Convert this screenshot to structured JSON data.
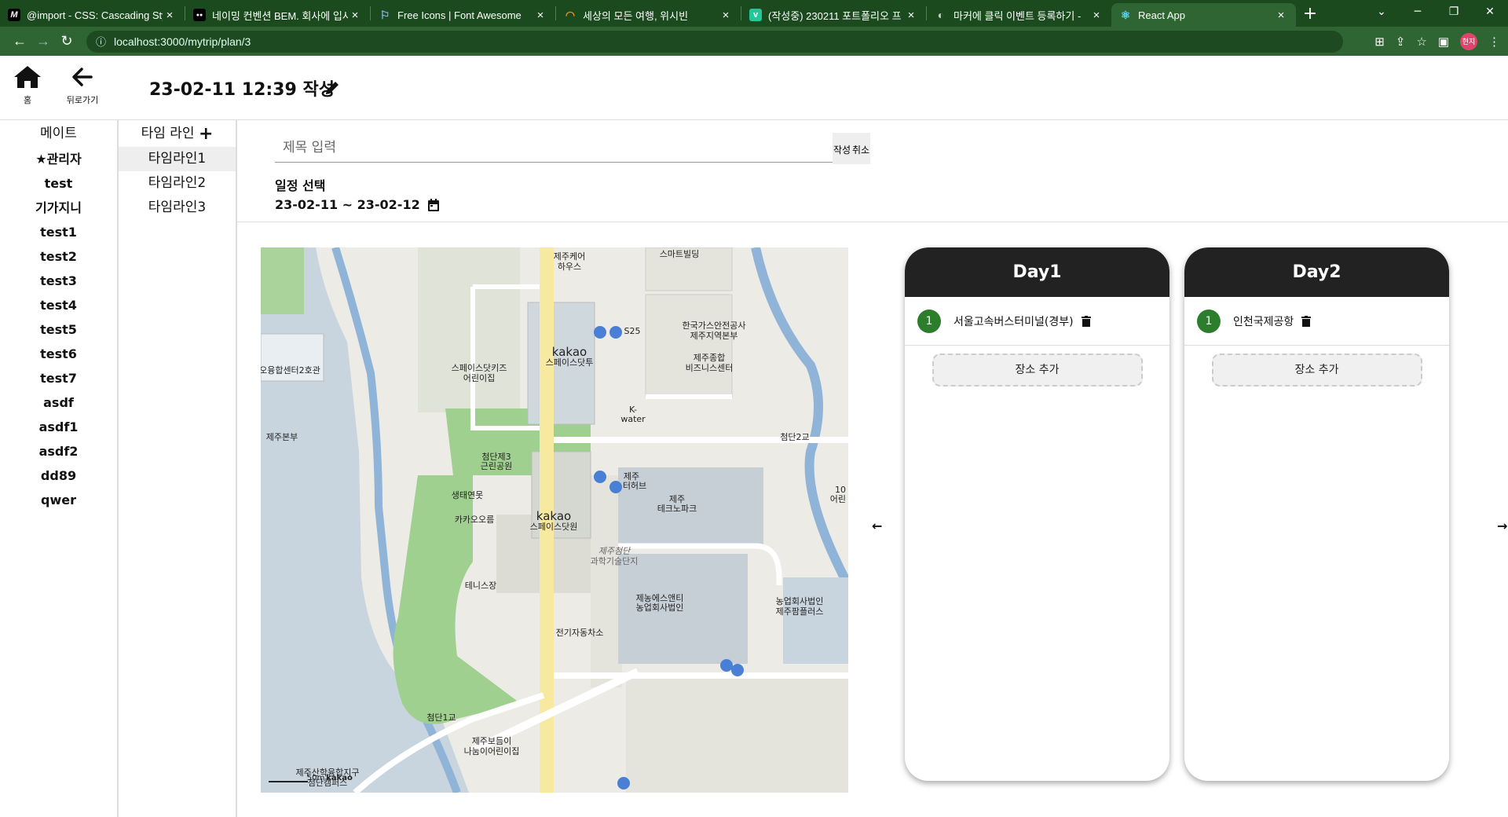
{
  "browser": {
    "tabs": [
      {
        "title": "@import - CSS: Cascading Styl",
        "favicon": "M",
        "favicon_color": "#000000"
      },
      {
        "title": "네이밍 컨벤션 BEM. 회사에 입사",
        "favicon": "●●",
        "favicon_color": "#000000"
      },
      {
        "title": "Free Icons | Font Awesome",
        "favicon": "⚐",
        "favicon_color": "#1b4a1e"
      },
      {
        "title": "세상의 모든 여행, 위시빈",
        "favicon": "◠",
        "favicon_color": "#1b4a1e"
      },
      {
        "title": "(작성중) 230211 포트폴리오 프",
        "favicon": "v",
        "favicon_color": "#20c997"
      },
      {
        "title": "마커에 클릭 이벤트 등록하기 -",
        "favicon": "◐",
        "favicon_color": "#1b4a1e"
      },
      {
        "title": "React App",
        "favicon": "⚛",
        "favicon_color": "#2f6532"
      }
    ],
    "url": "localhost:3000/mytrip/plan/3",
    "profile": "현지"
  },
  "header": {
    "home_label": "홈",
    "back_label": "뒤로가기",
    "title": "23-02-11 12:39 작성"
  },
  "mates": {
    "title": "메이트",
    "items": [
      "★관리자",
      "test",
      "기가지니",
      "test1",
      "test2",
      "test3",
      "test4",
      "test5",
      "test6",
      "test7",
      "asdf",
      "asdf1",
      "asdf2",
      "dd89",
      "qwer"
    ]
  },
  "timeline": {
    "title": "타임 라인",
    "add_icon": "plus-icon",
    "items": [
      "타임라인1",
      "타임라인2",
      "타임라인3"
    ]
  },
  "form": {
    "title_placeholder": "제목 입력",
    "write_btn": "작성",
    "cancel_btn": "취소",
    "schedule_label": "일정 선택",
    "date_range": "23-02-11 ~ 23-02-12"
  },
  "map": {
    "labels": {
      "l1": "제주케어",
      "l2": "하우스",
      "l3": "스마트빌딩",
      "l4": "S25",
      "l5": "한국가스안전공사",
      "l6": "제주지역본부",
      "l7": "kakao",
      "l8": "스페이스닷투",
      "l9": "스페이스닷키즈",
      "l10": "어린이집",
      "l11": "오융합센터2호관",
      "l12": "제주종합",
      "l13": "비즈니스센터",
      "l14": "K-",
      "l15": "water",
      "l16": "제주본부",
      "l17": "첨단2교",
      "l18": "첨단제3",
      "l19": "근린공원",
      "l20": "제주",
      "l21": "터허브",
      "l22": "10",
      "l23": "어린",
      "l24": "생태연못",
      "l25": "제주",
      "l26": "테크노파크",
      "l27": "카카오오름",
      "l28": "kakao",
      "l29": "스페이스닷원",
      "l30": "제주첨단",
      "l31": "과학기술단지",
      "l32": "테니스장",
      "l33": "제농에스앤티",
      "l34": "농업회사법인",
      "l35": "농업회사법인",
      "l36": "제주팜플러스",
      "l37": "전기자동차소",
      "l38": "첨단1교",
      "l39": "제주보듬이",
      "l40": "나눔이어린이집",
      "l41": "제주산학융합지구",
      "l42": "첨단캠퍼스",
      "l43": "50m",
      "l44": "kakao"
    }
  },
  "days": [
    {
      "title": "Day1",
      "places": [
        {
          "num": "1",
          "name": "서울고속버스터미널(경부)"
        }
      ],
      "add_label": "장소 추가"
    },
    {
      "title": "Day2",
      "places": [
        {
          "num": "1",
          "name": "인천국제공항"
        }
      ],
      "add_label": "장소 추가"
    }
  ],
  "colors": {
    "tab_bar": "#1b4a1e",
    "toolbar": "#2f6532",
    "day_header": "#222222",
    "badge": "#2c7d2c"
  }
}
